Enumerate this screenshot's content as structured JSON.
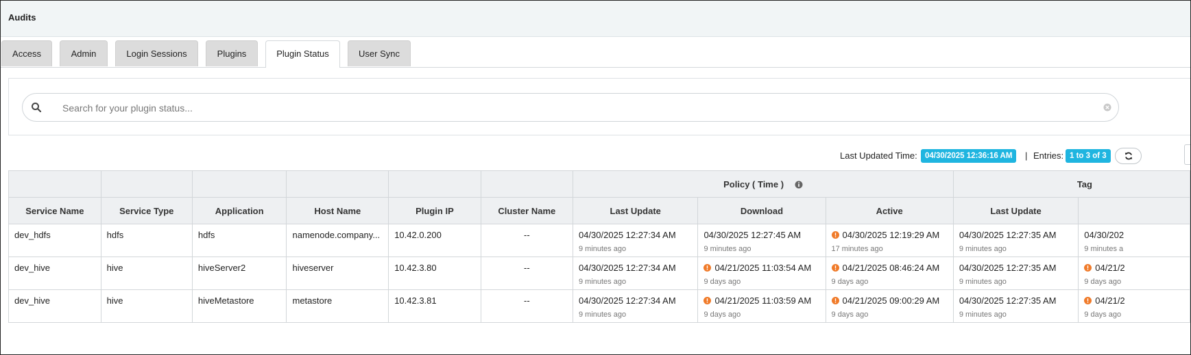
{
  "header": {
    "title": "Audits"
  },
  "tabs": [
    {
      "label": "Access"
    },
    {
      "label": "Admin"
    },
    {
      "label": "Login Sessions"
    },
    {
      "label": "Plugins"
    },
    {
      "label": "Plugin Status",
      "active": true
    },
    {
      "label": "User Sync"
    }
  ],
  "search": {
    "placeholder": "Search for your plugin status...",
    "value": ""
  },
  "status_bar": {
    "last_updated_label": "Last Updated Time:",
    "last_updated_value": "04/30/2025 12:36:16 AM",
    "separator": "|",
    "entries_label": "Entries:",
    "entries_value": "1 to 3 of 3"
  },
  "colors": {
    "accent_badge": "#1fb5e0",
    "warning": "#f07b2a",
    "header_bg": "#eef0f2"
  },
  "icons": {
    "search": "search-icon",
    "clear": "clear-icon",
    "refresh": "refresh-icon",
    "info": "info-icon",
    "warning": "warning-icon"
  },
  "table": {
    "group_headers": {
      "policy": "Policy ( Time )",
      "tag": "Tag"
    },
    "columns": [
      "Service Name",
      "Service Type",
      "Application",
      "Host Name",
      "Plugin IP",
      "Cluster Name",
      "Last Update",
      "Download",
      "Active",
      "Last Update",
      ""
    ],
    "rows": [
      {
        "service_name": "dev_hdfs",
        "service_type": "hdfs",
        "application": "hdfs",
        "host_name": "namenode.company...",
        "plugin_ip": "10.42.0.200",
        "cluster_name": "--",
        "policy_last_update": {
          "time": "04/30/2025 12:27:34 AM",
          "ago": "9 minutes ago",
          "warn": false
        },
        "policy_download": {
          "time": "04/30/2025 12:27:45 AM",
          "ago": "9 minutes ago",
          "warn": false
        },
        "policy_active": {
          "time": "04/30/2025 12:19:29 AM",
          "ago": "17 minutes ago",
          "warn": true
        },
        "tag_last_update": {
          "time": "04/30/2025 12:27:35 AM",
          "ago": "9 minutes ago",
          "warn": false
        },
        "tag_download": {
          "time": "04/30/202",
          "ago": "9 minutes a",
          "warn": false
        }
      },
      {
        "service_name": "dev_hive",
        "service_type": "hive",
        "application": "hiveServer2",
        "host_name": "hiveserver",
        "plugin_ip": "10.42.3.80",
        "cluster_name": "--",
        "policy_last_update": {
          "time": "04/30/2025 12:27:34 AM",
          "ago": "9 minutes ago",
          "warn": false
        },
        "policy_download": {
          "time": "04/21/2025 11:03:54 AM",
          "ago": "9 days ago",
          "warn": true
        },
        "policy_active": {
          "time": "04/21/2025 08:46:24 AM",
          "ago": "9 days ago",
          "warn": true
        },
        "tag_last_update": {
          "time": "04/30/2025 12:27:35 AM",
          "ago": "9 minutes ago",
          "warn": false
        },
        "tag_download": {
          "time": "04/21/2",
          "ago": "9 days ago",
          "warn": true
        }
      },
      {
        "service_name": "dev_hive",
        "service_type": "hive",
        "application": "hiveMetastore",
        "host_name": "metastore",
        "plugin_ip": "10.42.3.81",
        "cluster_name": "--",
        "policy_last_update": {
          "time": "04/30/2025 12:27:34 AM",
          "ago": "9 minutes ago",
          "warn": false
        },
        "policy_download": {
          "time": "04/21/2025 11:03:59 AM",
          "ago": "9 days ago",
          "warn": true
        },
        "policy_active": {
          "time": "04/21/2025 09:00:29 AM",
          "ago": "9 days ago",
          "warn": true
        },
        "tag_last_update": {
          "time": "04/30/2025 12:27:35 AM",
          "ago": "9 minutes ago",
          "warn": false
        },
        "tag_download": {
          "time": "04/21/2",
          "ago": "9 days ago",
          "warn": true
        }
      }
    ]
  }
}
